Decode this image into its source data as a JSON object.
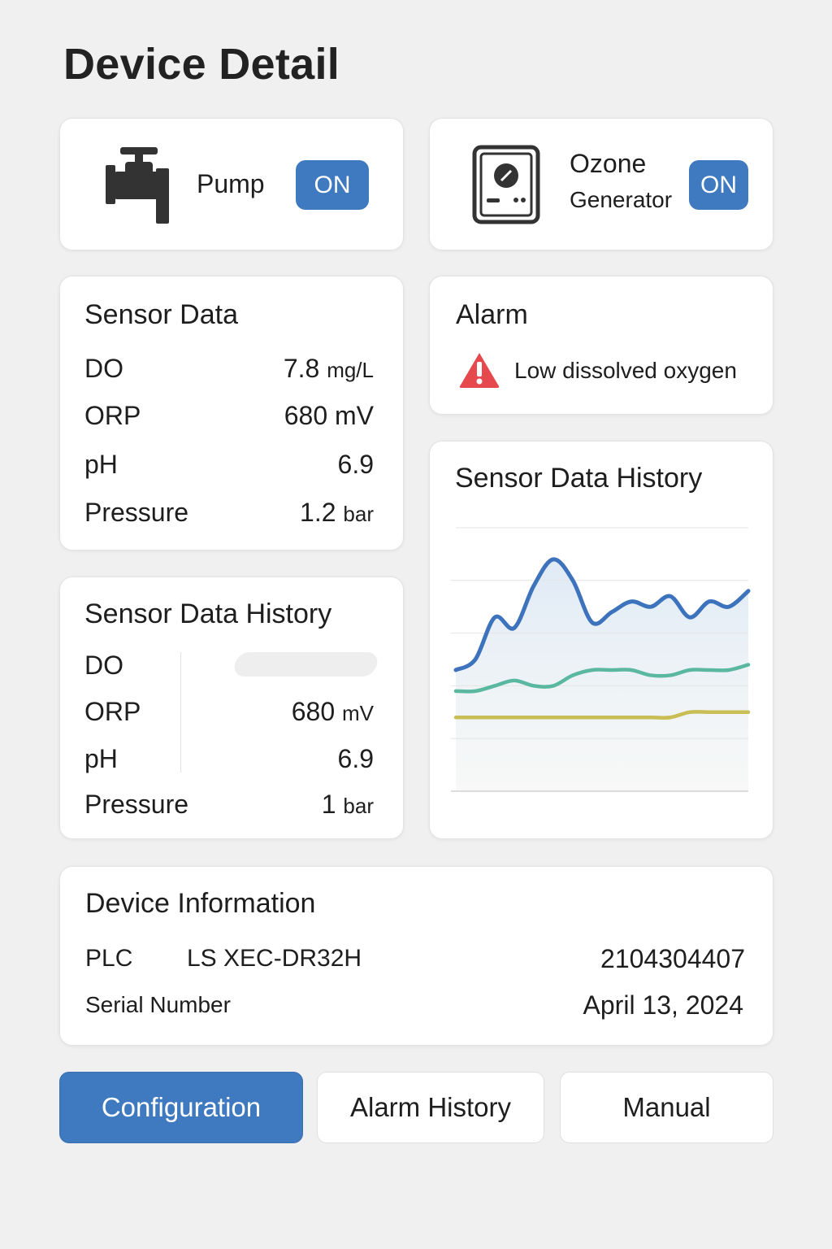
{
  "page": {
    "title": "Device Detail"
  },
  "controls": {
    "pump": {
      "label": "Pump",
      "state": "ON",
      "icon": "valve-icon"
    },
    "ozone": {
      "label_line1": "Ozone",
      "label_line2": "Generator",
      "state": "ON",
      "icon": "ozone-generator-icon"
    }
  },
  "sensor_data": {
    "title": "Sensor Data",
    "rows": [
      {
        "label": "DO",
        "value": "7.8",
        "unit": "mg/L"
      },
      {
        "label": "ORP",
        "value": "680 mV",
        "unit": ""
      },
      {
        "label": "pH",
        "value": "6.9",
        "unit": ""
      },
      {
        "label": "Pressure",
        "value": "1.2",
        "unit": "bar"
      }
    ]
  },
  "alarm": {
    "title": "Alarm",
    "message": "Low dissolved oxygen",
    "icon": "warning-triangle-icon",
    "color": "#e5484d"
  },
  "history_table": {
    "title": "Sensor Data History",
    "rows": [
      {
        "label": "DO",
        "value": ""
      },
      {
        "label": "ORP",
        "value": "680",
        "unit": "mV"
      },
      {
        "label": "pH",
        "value": "6.9",
        "unit": ""
      },
      {
        "label": "Pressure",
        "value": "1",
        "unit": "bar"
      }
    ]
  },
  "chart_data": {
    "type": "area",
    "title": "Sensor Data History",
    "xlabel": "",
    "ylabel": "",
    "ylim": [
      0,
      5
    ],
    "grid": true,
    "legend": "none",
    "x": [
      0,
      1,
      2,
      3,
      4,
      5,
      6,
      7,
      8,
      9,
      10,
      11,
      12,
      13,
      14,
      15
    ],
    "series": [
      {
        "color": "#3d72bd",
        "values": [
          2.3,
          2.5,
          3.3,
          3.1,
          3.9,
          4.4,
          4.0,
          3.2,
          3.4,
          3.6,
          3.5,
          3.7,
          3.3,
          3.6,
          3.5,
          3.8
        ]
      },
      {
        "color": "#5bb8a0",
        "values": [
          1.9,
          1.9,
          2.0,
          2.1,
          2.0,
          2.0,
          2.2,
          2.3,
          2.3,
          2.3,
          2.2,
          2.2,
          2.3,
          2.3,
          2.3,
          2.4
        ]
      },
      {
        "color": "#c9bd55",
        "values": [
          1.4,
          1.4,
          1.4,
          1.4,
          1.4,
          1.4,
          1.4,
          1.4,
          1.4,
          1.4,
          1.4,
          1.4,
          1.5,
          1.5,
          1.5,
          1.5
        ]
      }
    ]
  },
  "device_info": {
    "title": "Device Information",
    "plc_label": "PLC",
    "plc_value": "LS XEC-DR32H",
    "serial_label": "Serial Number",
    "serial_value": "2104304407",
    "date_value": "April 13, 2024"
  },
  "buttons": {
    "configuration": "Configuration",
    "alarm_history": "Alarm History",
    "manual": "Manual"
  },
  "colors": {
    "accent": "#3f79c0",
    "background": "#f0f0f0",
    "card": "#ffffff"
  }
}
